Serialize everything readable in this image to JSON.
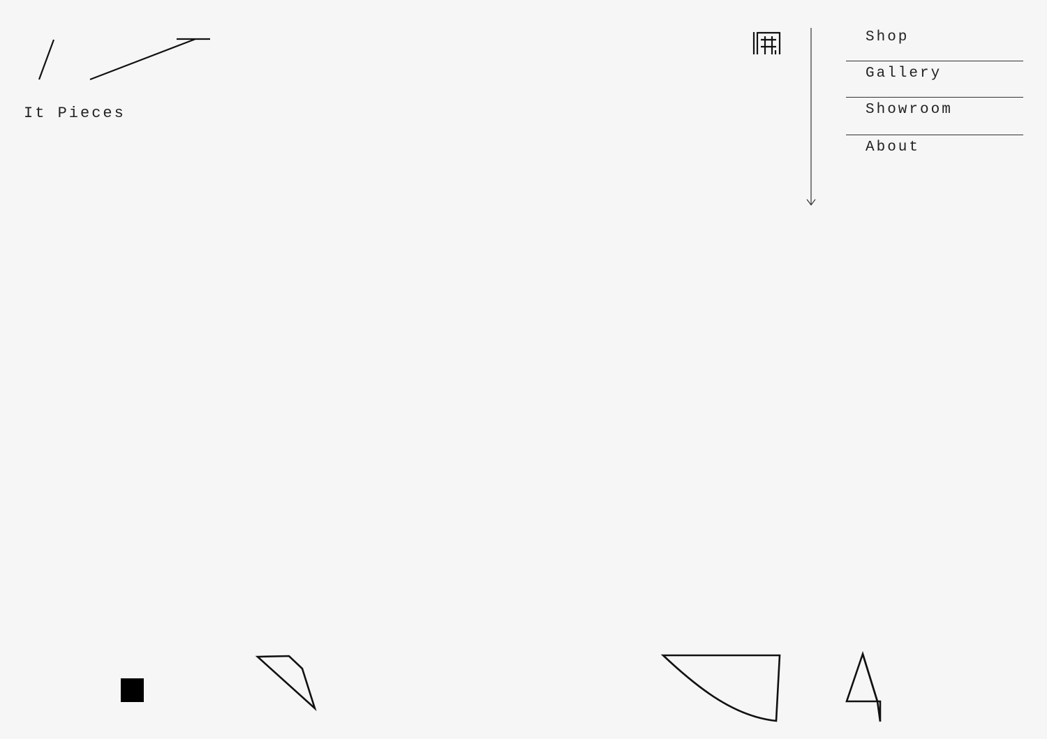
{
  "brand": {
    "name": "It Pieces"
  },
  "header": {
    "stamp_icon": "kanji-stamp-icon",
    "scroll_icon": "arrow-down-icon"
  },
  "nav": {
    "items": [
      {
        "label": "Shop"
      },
      {
        "label": "Gallery"
      },
      {
        "label": "Showroom"
      },
      {
        "label": "About"
      }
    ]
  },
  "decor": {
    "shapes": [
      "square-shape",
      "quadrilateral-shape",
      "wedge-shape",
      "four-glyph-shape"
    ]
  },
  "colors": {
    "background": "#f6f6f6",
    "ink": "#111111"
  }
}
